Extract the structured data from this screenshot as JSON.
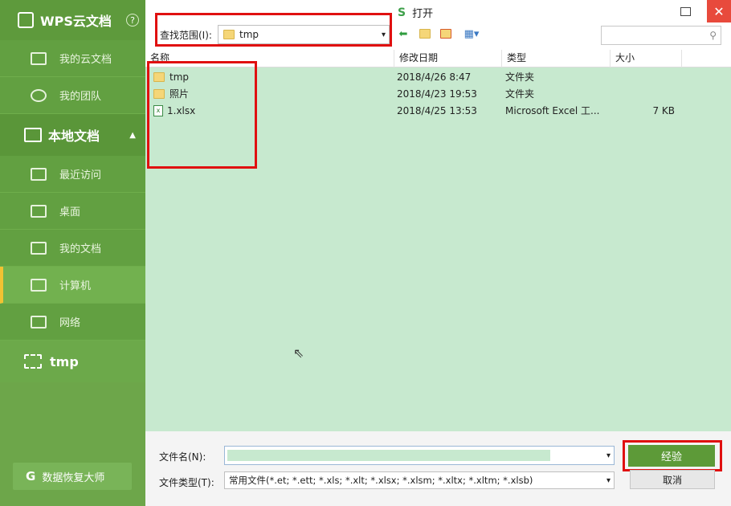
{
  "sidebar": {
    "brand": "WPS云文档",
    "help": "?",
    "cloud_items": [
      {
        "label": "我的云文档"
      },
      {
        "label": "我的团队"
      }
    ],
    "local_section": "本地文档",
    "local_items": [
      {
        "label": "最近访问"
      },
      {
        "label": "桌面"
      },
      {
        "label": "我的文档"
      },
      {
        "label": "计算机"
      },
      {
        "label": "网络"
      }
    ],
    "pinned_folder": "tmp",
    "recover_icon": "G",
    "recover_label": "数据恢复大师"
  },
  "dialog": {
    "app_logo": "S",
    "title": "打开",
    "look_in_label": "查找范围(I):",
    "look_in_value": "tmp",
    "search_placeholder": ""
  },
  "columns": [
    "名称",
    "修改日期",
    "类型",
    "大小"
  ],
  "files": [
    {
      "name": "tmp",
      "date": "2018/4/26 8:47",
      "type": "文件夹",
      "size": "",
      "kind": "folder"
    },
    {
      "name": "照片",
      "date": "2018/4/23 19:53",
      "type": "文件夹",
      "size": "",
      "kind": "folder"
    },
    {
      "name": "1.xlsx",
      "date": "2018/4/25 13:53",
      "type": "Microsoft Excel 工...",
      "size": "7 KB",
      "kind": "xlsx"
    }
  ],
  "footer": {
    "filename_label": "文件名(N):",
    "filename_value": "",
    "filetype_label": "文件类型(T):",
    "filetype_value": "常用文件(*.et; *.ett; *.xls; *.xlt; *.xlsx; *.xlsm; *.xltx; *.xltm; *.xlsb)",
    "open_label": "经验",
    "cancel_label": "取消"
  },
  "colors": {
    "sidebar_bg": "#6da64a",
    "list_bg": "#c7e9cf",
    "highlight_red": "#e01010",
    "accent_yellow": "#f2c232"
  }
}
